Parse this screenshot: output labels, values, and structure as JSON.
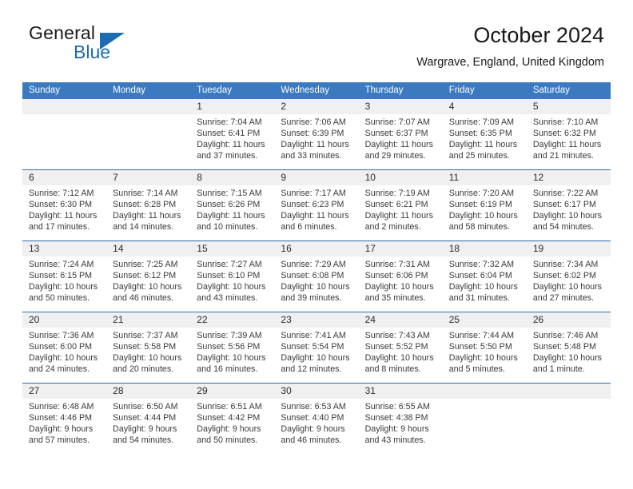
{
  "brand": {
    "name_top": "General",
    "name_bottom": "Blue",
    "mark": "triangle-logo"
  },
  "header": {
    "title": "October 2024",
    "subtitle": "Wargrave, England, United Kingdom"
  },
  "colors": {
    "header_blue": "#3b79c0",
    "week_divider": "#2f6ca8",
    "day_band": "#f0f0f0",
    "brand_blue": "#1b6cb0",
    "text": "#3a3a3a"
  },
  "calendar": {
    "weekday_headers": [
      "Sunday",
      "Monday",
      "Tuesday",
      "Wednesday",
      "Thursday",
      "Friday",
      "Saturday"
    ],
    "weeks": [
      [
        {
          "day": "",
          "sunrise": "",
          "sunset": "",
          "daylight_1": "",
          "daylight_2": ""
        },
        {
          "day": "",
          "sunrise": "",
          "sunset": "",
          "daylight_1": "",
          "daylight_2": ""
        },
        {
          "day": "1",
          "sunrise": "Sunrise: 7:04 AM",
          "sunset": "Sunset: 6:41 PM",
          "daylight_1": "Daylight: 11 hours",
          "daylight_2": "and 37 minutes."
        },
        {
          "day": "2",
          "sunrise": "Sunrise: 7:06 AM",
          "sunset": "Sunset: 6:39 PM",
          "daylight_1": "Daylight: 11 hours",
          "daylight_2": "and 33 minutes."
        },
        {
          "day": "3",
          "sunrise": "Sunrise: 7:07 AM",
          "sunset": "Sunset: 6:37 PM",
          "daylight_1": "Daylight: 11 hours",
          "daylight_2": "and 29 minutes."
        },
        {
          "day": "4",
          "sunrise": "Sunrise: 7:09 AM",
          "sunset": "Sunset: 6:35 PM",
          "daylight_1": "Daylight: 11 hours",
          "daylight_2": "and 25 minutes."
        },
        {
          "day": "5",
          "sunrise": "Sunrise: 7:10 AM",
          "sunset": "Sunset: 6:32 PM",
          "daylight_1": "Daylight: 11 hours",
          "daylight_2": "and 21 minutes."
        }
      ],
      [
        {
          "day": "6",
          "sunrise": "Sunrise: 7:12 AM",
          "sunset": "Sunset: 6:30 PM",
          "daylight_1": "Daylight: 11 hours",
          "daylight_2": "and 17 minutes."
        },
        {
          "day": "7",
          "sunrise": "Sunrise: 7:14 AM",
          "sunset": "Sunset: 6:28 PM",
          "daylight_1": "Daylight: 11 hours",
          "daylight_2": "and 14 minutes."
        },
        {
          "day": "8",
          "sunrise": "Sunrise: 7:15 AM",
          "sunset": "Sunset: 6:26 PM",
          "daylight_1": "Daylight: 11 hours",
          "daylight_2": "and 10 minutes."
        },
        {
          "day": "9",
          "sunrise": "Sunrise: 7:17 AM",
          "sunset": "Sunset: 6:23 PM",
          "daylight_1": "Daylight: 11 hours",
          "daylight_2": "and 6 minutes."
        },
        {
          "day": "10",
          "sunrise": "Sunrise: 7:19 AM",
          "sunset": "Sunset: 6:21 PM",
          "daylight_1": "Daylight: 11 hours",
          "daylight_2": "and 2 minutes."
        },
        {
          "day": "11",
          "sunrise": "Sunrise: 7:20 AM",
          "sunset": "Sunset: 6:19 PM",
          "daylight_1": "Daylight: 10 hours",
          "daylight_2": "and 58 minutes."
        },
        {
          "day": "12",
          "sunrise": "Sunrise: 7:22 AM",
          "sunset": "Sunset: 6:17 PM",
          "daylight_1": "Daylight: 10 hours",
          "daylight_2": "and 54 minutes."
        }
      ],
      [
        {
          "day": "13",
          "sunrise": "Sunrise: 7:24 AM",
          "sunset": "Sunset: 6:15 PM",
          "daylight_1": "Daylight: 10 hours",
          "daylight_2": "and 50 minutes."
        },
        {
          "day": "14",
          "sunrise": "Sunrise: 7:25 AM",
          "sunset": "Sunset: 6:12 PM",
          "daylight_1": "Daylight: 10 hours",
          "daylight_2": "and 46 minutes."
        },
        {
          "day": "15",
          "sunrise": "Sunrise: 7:27 AM",
          "sunset": "Sunset: 6:10 PM",
          "daylight_1": "Daylight: 10 hours",
          "daylight_2": "and 43 minutes."
        },
        {
          "day": "16",
          "sunrise": "Sunrise: 7:29 AM",
          "sunset": "Sunset: 6:08 PM",
          "daylight_1": "Daylight: 10 hours",
          "daylight_2": "and 39 minutes."
        },
        {
          "day": "17",
          "sunrise": "Sunrise: 7:31 AM",
          "sunset": "Sunset: 6:06 PM",
          "daylight_1": "Daylight: 10 hours",
          "daylight_2": "and 35 minutes."
        },
        {
          "day": "18",
          "sunrise": "Sunrise: 7:32 AM",
          "sunset": "Sunset: 6:04 PM",
          "daylight_1": "Daylight: 10 hours",
          "daylight_2": "and 31 minutes."
        },
        {
          "day": "19",
          "sunrise": "Sunrise: 7:34 AM",
          "sunset": "Sunset: 6:02 PM",
          "daylight_1": "Daylight: 10 hours",
          "daylight_2": "and 27 minutes."
        }
      ],
      [
        {
          "day": "20",
          "sunrise": "Sunrise: 7:36 AM",
          "sunset": "Sunset: 6:00 PM",
          "daylight_1": "Daylight: 10 hours",
          "daylight_2": "and 24 minutes."
        },
        {
          "day": "21",
          "sunrise": "Sunrise: 7:37 AM",
          "sunset": "Sunset: 5:58 PM",
          "daylight_1": "Daylight: 10 hours",
          "daylight_2": "and 20 minutes."
        },
        {
          "day": "22",
          "sunrise": "Sunrise: 7:39 AM",
          "sunset": "Sunset: 5:56 PM",
          "daylight_1": "Daylight: 10 hours",
          "daylight_2": "and 16 minutes."
        },
        {
          "day": "23",
          "sunrise": "Sunrise: 7:41 AM",
          "sunset": "Sunset: 5:54 PM",
          "daylight_1": "Daylight: 10 hours",
          "daylight_2": "and 12 minutes."
        },
        {
          "day": "24",
          "sunrise": "Sunrise: 7:43 AM",
          "sunset": "Sunset: 5:52 PM",
          "daylight_1": "Daylight: 10 hours",
          "daylight_2": "and 8 minutes."
        },
        {
          "day": "25",
          "sunrise": "Sunrise: 7:44 AM",
          "sunset": "Sunset: 5:50 PM",
          "daylight_1": "Daylight: 10 hours",
          "daylight_2": "and 5 minutes."
        },
        {
          "day": "26",
          "sunrise": "Sunrise: 7:46 AM",
          "sunset": "Sunset: 5:48 PM",
          "daylight_1": "Daylight: 10 hours",
          "daylight_2": "and 1 minute."
        }
      ],
      [
        {
          "day": "27",
          "sunrise": "Sunrise: 6:48 AM",
          "sunset": "Sunset: 4:46 PM",
          "daylight_1": "Daylight: 9 hours",
          "daylight_2": "and 57 minutes."
        },
        {
          "day": "28",
          "sunrise": "Sunrise: 6:50 AM",
          "sunset": "Sunset: 4:44 PM",
          "daylight_1": "Daylight: 9 hours",
          "daylight_2": "and 54 minutes."
        },
        {
          "day": "29",
          "sunrise": "Sunrise: 6:51 AM",
          "sunset": "Sunset: 4:42 PM",
          "daylight_1": "Daylight: 9 hours",
          "daylight_2": "and 50 minutes."
        },
        {
          "day": "30",
          "sunrise": "Sunrise: 6:53 AM",
          "sunset": "Sunset: 4:40 PM",
          "daylight_1": "Daylight: 9 hours",
          "daylight_2": "and 46 minutes."
        },
        {
          "day": "31",
          "sunrise": "Sunrise: 6:55 AM",
          "sunset": "Sunset: 4:38 PM",
          "daylight_1": "Daylight: 9 hours",
          "daylight_2": "and 43 minutes."
        },
        {
          "day": "",
          "sunrise": "",
          "sunset": "",
          "daylight_1": "",
          "daylight_2": ""
        },
        {
          "day": "",
          "sunrise": "",
          "sunset": "",
          "daylight_1": "",
          "daylight_2": ""
        }
      ]
    ]
  }
}
